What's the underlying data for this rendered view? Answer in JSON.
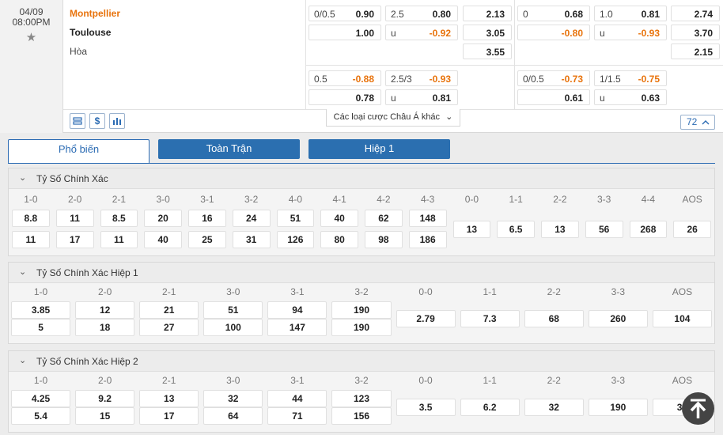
{
  "match": {
    "date": "04/09",
    "time": "08:00PM",
    "home": "Montpellier",
    "away": "Toulouse",
    "draw": "Hòa"
  },
  "odds": {
    "r1": [
      {
        "l": "0/0.5",
        "r": "0.90",
        "neg": false
      },
      {
        "l": "2.5",
        "r": "0.80",
        "neg": false
      },
      {
        "l": "",
        "r": "2.13",
        "neg": false
      },
      {
        "l": "0",
        "r": "0.68",
        "neg": false
      },
      {
        "l": "1.0",
        "r": "0.81",
        "neg": false
      },
      {
        "l": "",
        "r": "2.74",
        "neg": false
      }
    ],
    "r2": [
      {
        "l": "",
        "r": "1.00",
        "neg": false
      },
      {
        "l": "u",
        "r": "-0.92",
        "neg": true
      },
      {
        "l": "",
        "r": "3.05",
        "neg": false
      },
      {
        "l": "",
        "r": "-0.80",
        "neg": true
      },
      {
        "l": "u",
        "r": "-0.93",
        "neg": true
      },
      {
        "l": "",
        "r": "3.70",
        "neg": false
      }
    ],
    "r3": [
      {
        "l": "",
        "r": "3.55",
        "neg": false
      },
      {
        "l": "",
        "r": "2.15",
        "neg": false
      }
    ],
    "r4": [
      {
        "l": "0.5",
        "r": "-0.88",
        "neg": true
      },
      {
        "l": "2.5/3",
        "r": "-0.93",
        "neg": true
      },
      {
        "l": "0/0.5",
        "r": "-0.73",
        "neg": true
      },
      {
        "l": "1/1.5",
        "r": "-0.75",
        "neg": true
      }
    ],
    "r5": [
      {
        "l": "",
        "r": "0.78",
        "neg": false
      },
      {
        "l": "u",
        "r": "0.81",
        "neg": false
      },
      {
        "l": "",
        "r": "0.61",
        "neg": false
      },
      {
        "l": "u",
        "r": "0.63",
        "neg": false
      }
    ]
  },
  "toolbar": {
    "icons": [
      "list-icon",
      "dollar-icon",
      "bar-chart-icon"
    ],
    "other_bets": "Các loại cược Châu Á khác",
    "market_count": "72"
  },
  "tabs": {
    "popular": "Phổ biến",
    "full": "Toàn Trận",
    "half": "Hiệp 1"
  },
  "panels": [
    {
      "title": "Tỷ Số Chính Xác",
      "pairs": [
        {
          "h": "1-0",
          "a": "8.8",
          "b": "11"
        },
        {
          "h": "2-0",
          "a": "11",
          "b": "17"
        },
        {
          "h": "2-1",
          "a": "8.5",
          "b": "11"
        },
        {
          "h": "3-0",
          "a": "20",
          "b": "40"
        },
        {
          "h": "3-1",
          "a": "16",
          "b": "25"
        },
        {
          "h": "3-2",
          "a": "24",
          "b": "31"
        },
        {
          "h": "4-0",
          "a": "51",
          "b": "126"
        },
        {
          "h": "4-1",
          "a": "40",
          "b": "80"
        },
        {
          "h": "4-2",
          "a": "62",
          "b": "98"
        },
        {
          "h": "4-3",
          "a": "148",
          "b": "186"
        }
      ],
      "singles": [
        {
          "h": "0-0",
          "v": "13"
        },
        {
          "h": "1-1",
          "v": "6.5"
        },
        {
          "h": "2-2",
          "v": "13"
        },
        {
          "h": "3-3",
          "v": "56"
        },
        {
          "h": "4-4",
          "v": "268"
        },
        {
          "h": "AOS",
          "v": "26"
        }
      ]
    },
    {
      "title": "Tỷ Số Chính Xác Hiệp 1",
      "pairs": [
        {
          "h": "1-0",
          "a": "3.85",
          "b": "5"
        },
        {
          "h": "2-0",
          "a": "12",
          "b": "18"
        },
        {
          "h": "2-1",
          "a": "21",
          "b": "27"
        },
        {
          "h": "3-0",
          "a": "51",
          "b": "100"
        },
        {
          "h": "3-1",
          "a": "94",
          "b": "147"
        },
        {
          "h": "3-2",
          "a": "190",
          "b": "190"
        }
      ],
      "singles": [
        {
          "h": "0-0",
          "v": "2.79"
        },
        {
          "h": "1-1",
          "v": "7.3"
        },
        {
          "h": "2-2",
          "v": "68"
        },
        {
          "h": "3-3",
          "v": "260"
        },
        {
          "h": "AOS",
          "v": "104"
        }
      ]
    },
    {
      "title": "Tỷ Số Chính Xác Hiệp 2",
      "pairs": [
        {
          "h": "1-0",
          "a": "4.25",
          "b": "5.4"
        },
        {
          "h": "2-0",
          "a": "9.2",
          "b": "15"
        },
        {
          "h": "2-1",
          "a": "13",
          "b": "17"
        },
        {
          "h": "3-0",
          "a": "32",
          "b": "64"
        },
        {
          "h": "3-1",
          "a": "44",
          "b": "71"
        },
        {
          "h": "3-2",
          "a": "123",
          "b": "156"
        }
      ],
      "singles": [
        {
          "h": "0-0",
          "v": "3.5"
        },
        {
          "h": "1-1",
          "v": "6.2"
        },
        {
          "h": "2-2",
          "v": "32"
        },
        {
          "h": "3-3",
          "v": "190"
        },
        {
          "h": "AOS",
          "v": "39"
        }
      ]
    }
  ],
  "colors": {
    "accent": "#2b6fb0",
    "home_team": "#e8730c",
    "negative_odds": "#e8730c"
  }
}
